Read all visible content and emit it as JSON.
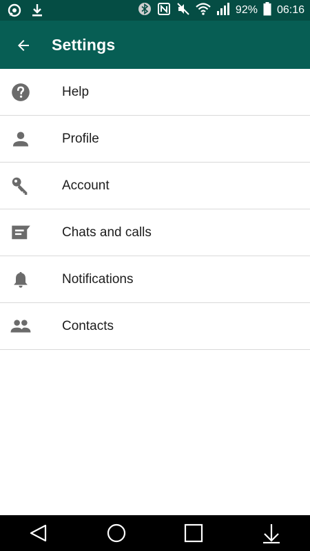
{
  "status_bar": {
    "battery_percent": "92%",
    "time": "06:16",
    "icons": [
      "whatsapp-status-icon",
      "download-icon",
      "bluetooth-icon",
      "nfc-icon",
      "mute-icon",
      "wifi-icon",
      "signal-icon",
      "battery-icon"
    ]
  },
  "app_bar": {
    "title": "Settings",
    "back_icon": "arrow-back-icon"
  },
  "settings": {
    "items": [
      {
        "label": "Help",
        "icon": "help-icon"
      },
      {
        "label": "Profile",
        "icon": "person-icon"
      },
      {
        "label": "Account",
        "icon": "key-icon"
      },
      {
        "label": "Chats and calls",
        "icon": "chat-icon"
      },
      {
        "label": "Notifications",
        "icon": "bell-icon"
      },
      {
        "label": "Contacts",
        "icon": "people-icon"
      }
    ]
  },
  "nav_bar": {
    "buttons": [
      "back-triangle-icon",
      "home-circle-icon",
      "recents-square-icon",
      "notifications-pulldown-icon"
    ]
  },
  "colors": {
    "status_bar": "#054d44",
    "app_bar": "#075e54",
    "icon_gray": "#6b6b6b",
    "divider": "#d9d9d9"
  }
}
